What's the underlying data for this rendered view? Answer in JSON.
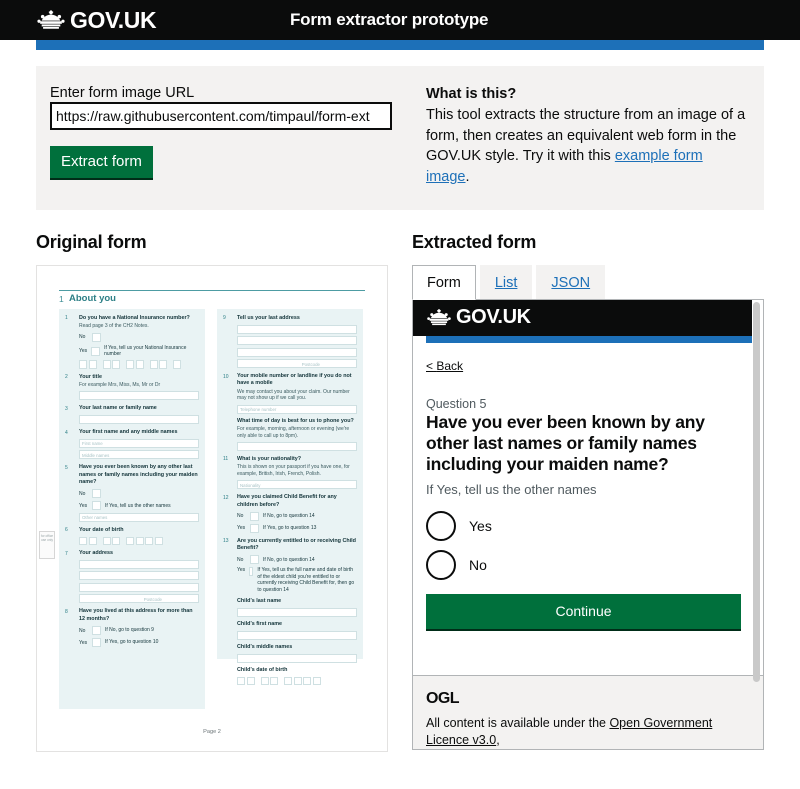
{
  "header": {
    "brand": "GOV.UK",
    "title": "Form extractor prototype",
    "crown_icon": "crown-icon"
  },
  "intro": {
    "url_label": "Enter form image URL",
    "url_value": "https://raw.githubusercontent.com/timpaul/form-ext",
    "url_placeholder": "https://",
    "extract_button": "Extract form",
    "what_heading": "What is this?",
    "what_body_before": "This tool extracts the structure from an image of a form, then creates an equivalent web form in the GOV.UK style. Try it with this ",
    "what_link": "example form image",
    "what_body_after": "."
  },
  "left_column": {
    "heading": "Original form",
    "scan": {
      "section_number": "1",
      "section_title": "About you",
      "page_label": "Page 2",
      "office_tab_text": "for office use only",
      "left_questions": [
        {
          "number": "1",
          "title": "Do you have a National Insurance number?",
          "hint": "Read page 3 of the CH2 Notes.",
          "no_label": "No",
          "yes_label": "Yes",
          "yes_text": "If Yes, tell us your National Insurance number"
        },
        {
          "number": "2",
          "title": "Your title",
          "hint": "For example Mrs, Miss, Ms, Mr or Dr"
        },
        {
          "number": "3",
          "title": "Your last name or family name",
          "hint": ""
        },
        {
          "number": "4",
          "title": "Your first name and any middle names",
          "hint": "",
          "placeholder_1": "First name",
          "placeholder_2": "Middle names"
        },
        {
          "number": "5",
          "title": "Have you ever been known by any other last names or family names including your maiden name?",
          "no_label": "No",
          "yes_label": "Yes",
          "yes_text": "If Yes, tell us the other names",
          "placeholder_1": "Other names"
        },
        {
          "number": "6",
          "title": "Your date of birth"
        },
        {
          "number": "7",
          "title": "Your address",
          "placeholder_postcode": "Postcode"
        },
        {
          "number": "8",
          "title": "Have you lived at this address for more than 12 months?",
          "no_label": "No",
          "no_text": "If No, go to question 9",
          "yes_label": "Yes",
          "yes_text": "If Yes, go to question 10"
        }
      ],
      "right_questions": [
        {
          "number": "9",
          "title": "Tell us your last address",
          "placeholder_postcode": "Postcode"
        },
        {
          "number": "10",
          "title": "Your mobile number or landline if you do not have a mobile",
          "hint": "We may contact you about your claim. Our number may not show up if we call you.",
          "placeholder_1": "Telephone number",
          "sub_title": "What time of day is best for us to phone you?",
          "sub_hint": "For example, morning, afternoon or evening (we're only able to call up to 8pm)."
        },
        {
          "number": "11",
          "title": "What is your nationality?",
          "hint": "This is shown on your passport if you have one, for example, British, Irish, French, Polish.",
          "placeholder_1": "Nationality"
        },
        {
          "number": "12",
          "title": "Have you claimed Child Benefit for any children before?",
          "no_label": "No",
          "no_text": "If No, go to question 14",
          "yes_label": "Yes",
          "yes_text": "If Yes, go to question 13"
        },
        {
          "number": "13",
          "title": "Are you currently entitled to or receiving Child Benefit?",
          "no_label": "No",
          "no_text": "If No, go to question 14",
          "yes_label": "Yes",
          "yes_text": "If Yes, tell us the full name and date of birth of the eldest child you're entitled to or currently receiving Child Benefit for, then go to question 14",
          "sub_fields": [
            "Child's last name",
            "Child's first name",
            "Child's middle names",
            "Child's date of birth"
          ]
        }
      ]
    }
  },
  "right_column": {
    "heading": "Extracted form",
    "tabs": [
      {
        "label": "Form",
        "active": true
      },
      {
        "label": "List",
        "active": false
      },
      {
        "label": "JSON",
        "active": false
      }
    ],
    "preview": {
      "brand": "GOV.UK",
      "back_chevron": "<",
      "back_label": "Back",
      "caption": "Question 5",
      "question": "Have you ever been known by any other last names or family names including your maiden name?",
      "hint": "If Yes, tell us the other names",
      "options": [
        {
          "label": "Yes"
        },
        {
          "label": "No"
        }
      ],
      "continue_label": "Continue",
      "ogl_label": "OGL",
      "footer_text_before": "All content is available under the ",
      "footer_link": "Open Government Licence v3.0",
      "footer_text_after": ","
    }
  },
  "colors": {
    "black": "#0b0c0c",
    "blue": "#1d70b8",
    "green": "#00703c",
    "grey_panel": "#f3f2f1",
    "scan_teal": "#2d7f86"
  }
}
